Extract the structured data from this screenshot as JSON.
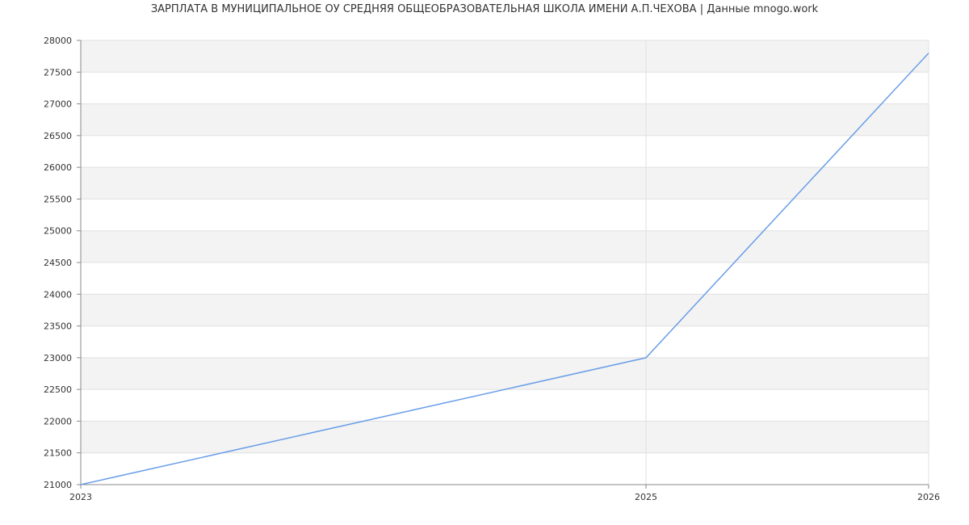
{
  "chart_data": {
    "type": "line",
    "title": "ЗАРПЛАТА В МУНИЦИПАЛЬНОЕ ОУ СРЕДНЯЯ ОБЩЕОБРАЗОВАТЕЛЬНАЯ ШКОЛА ИМЕНИ А.П.ЧЕХОВА | Данные mnogo.work",
    "xlabel": "",
    "ylabel": "",
    "x": [
      2023,
      2025,
      2026
    ],
    "x_tick_labels": [
      "2023",
      "2025",
      "2026"
    ],
    "series": [
      {
        "values": [
          21000,
          23000,
          27800
        ]
      }
    ],
    "ylim": [
      21000,
      28000
    ],
    "y_ticks": [
      21000,
      21500,
      22000,
      22500,
      23000,
      23500,
      24000,
      24500,
      25000,
      25500,
      26000,
      26500,
      27000,
      27500,
      28000
    ],
    "grid": true,
    "band_color": "#f3f3f3",
    "grid_color": "#e0e0e0",
    "axis_color": "#888888",
    "line_color": "#6a9ee8"
  }
}
